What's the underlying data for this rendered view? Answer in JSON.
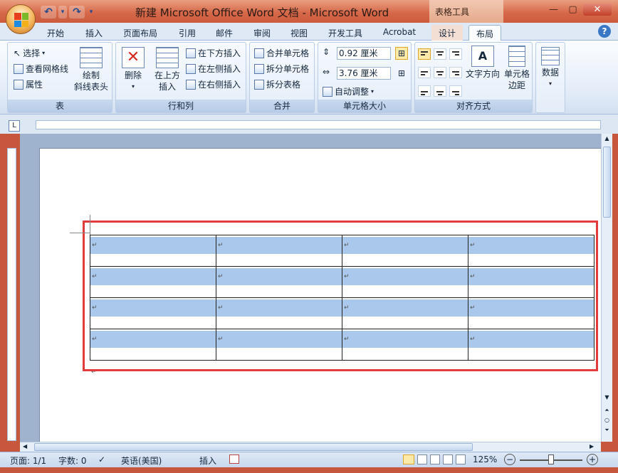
{
  "title": "新建 Microsoft Office Word 文档 - Microsoft Word",
  "context_tab_group": "表格工具",
  "tabs": [
    {
      "label": "开始"
    },
    {
      "label": "插入"
    },
    {
      "label": "页面布局"
    },
    {
      "label": "引用"
    },
    {
      "label": "邮件"
    },
    {
      "label": "审阅"
    },
    {
      "label": "视图"
    },
    {
      "label": "开发工具"
    },
    {
      "label": "Acrobat"
    },
    {
      "label": "设计"
    },
    {
      "label": "布局"
    }
  ],
  "active_tab": "布局",
  "ribbon": {
    "table_group": {
      "label": "表",
      "select": "选择",
      "view_gridlines": "查看网格线",
      "properties": "属性",
      "draw_diagonal_line1": "绘制",
      "draw_diagonal_line2": "斜线表头"
    },
    "rows_cols_group": {
      "label": "行和列",
      "delete": "删除",
      "insert_above1": "在上方",
      "insert_above2": "插入",
      "insert_below": "在下方插入",
      "insert_left": "在左侧插入",
      "insert_right": "在右侧插入"
    },
    "merge_group": {
      "label": "合并",
      "merge_cells": "合并单元格",
      "split_cells": "拆分单元格",
      "split_table": "拆分表格"
    },
    "cell_size_group": {
      "label": "单元格大小",
      "height": "0.92 厘米",
      "width": "3.76 厘米",
      "autofit": "自动调整"
    },
    "alignment_group": {
      "label": "对齐方式",
      "text_direction": "文字方向",
      "cell_margins1": "单元格",
      "cell_margins2": "边距"
    },
    "data_group": {
      "label": "数据"
    }
  },
  "status": {
    "page": "页面: 1/1",
    "words": "字数: 0",
    "language": "英语(美国)",
    "mode": "插入",
    "zoom": "125%"
  },
  "table": {
    "rows": 4,
    "cols": 4,
    "cell_mark": "↵"
  },
  "colors": {
    "title_bar": "#d6694a",
    "highlight_box": "#e23b3b",
    "cell_shading": "#a9c8ec"
  }
}
